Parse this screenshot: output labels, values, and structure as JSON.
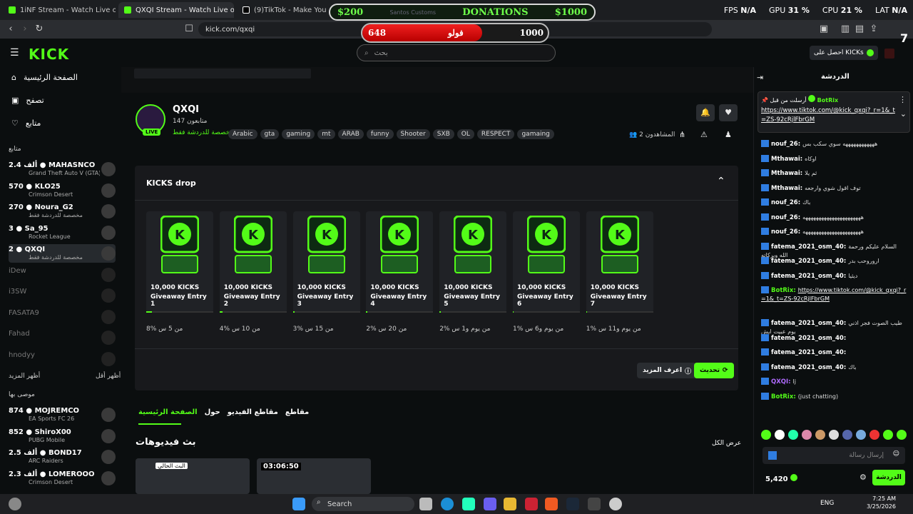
{
  "browser": {
    "tabs": [
      {
        "label": "1iNF Stream - Watch Live on Kick",
        "active": false
      },
      {
        "label": "QXQI Stream - Watch Live on Kick",
        "active": true
      },
      {
        "label": "(9)TikTok - Make Your Day",
        "active": false
      }
    ],
    "url": "kick.com/qxqi"
  },
  "overlay": {
    "donations": {
      "left": "$200",
      "title": "DONATIONS",
      "right": "$1000",
      "faded": "Santos Customs"
    },
    "followers": {
      "current": "648",
      "label": "فولو",
      "goal": "1000",
      "progress": 0.648
    },
    "stats": {
      "fps_label": "FPS",
      "fps": "N/A",
      "gpu_label": "GPU",
      "gpu": "31 %",
      "cpu_label": "CPU",
      "cpu": "21 %",
      "lat_label": "LAT",
      "lat": "N/A"
    }
  },
  "header": {
    "logo": "KICK",
    "search_placeholder": "بحث",
    "get_kicks": "احصل على KICKs",
    "kicks_count": "7"
  },
  "sidebar": {
    "nav": [
      {
        "label": "الصفحة الرئيسية",
        "icon": "home-icon"
      },
      {
        "label": "تصفح",
        "icon": "browse-icon"
      },
      {
        "label": "متابع",
        "icon": "heart-icon"
      }
    ],
    "following_title": "متابع",
    "following": [
      {
        "name": "MAHASNCO",
        "viewers": "2.4 ألف",
        "game": "Grand Theft Auto V (GTA)",
        "live": true
      },
      {
        "name": "KLO25",
        "viewers": "570",
        "game": "Crimson Desert",
        "live": true
      },
      {
        "name": "Noura_G2",
        "viewers": "270",
        "game": "مخصصة للدردشة فقط",
        "live": true
      },
      {
        "name": "Sa_95",
        "viewers": "3",
        "game": "Rocket League",
        "live": true
      },
      {
        "name": "QXQI",
        "viewers": "2",
        "game": "مخصصة للدردشة فقط",
        "live": true
      },
      {
        "name": "iDew",
        "viewers": "",
        "game": "",
        "live": false
      },
      {
        "name": "i3SW",
        "viewers": "",
        "game": "",
        "live": false
      },
      {
        "name": "FASATA9",
        "viewers": "",
        "game": "",
        "live": false
      },
      {
        "name": "Fahad",
        "viewers": "",
        "game": "",
        "live": false
      },
      {
        "name": "hnodyy",
        "viewers": "",
        "game": "",
        "live": false
      }
    ],
    "show_more": "أظهر المزيد",
    "show_less": "أظهر أقل",
    "recommended_title": "موصى بها",
    "recommended": [
      {
        "name": "MOJREMCO",
        "viewers": "874",
        "game": "EA Sports FC 26"
      },
      {
        "name": "ShiroX00",
        "viewers": "852",
        "game": "PUBG Mobile"
      },
      {
        "name": "BOND17",
        "viewers": "2.5 ألف",
        "game": "ARC Raiders"
      },
      {
        "name": "LOMEROOO",
        "viewers": "2.3 ألف",
        "game": "Crimson Desert"
      }
    ]
  },
  "channel": {
    "name": "QXQI",
    "followers": "147 متابعون",
    "category": "مخصصة للدردشة فقط",
    "live_badge": "LIVE",
    "tags": [
      "Arabic",
      "gta",
      "gaming",
      "mt",
      "ARAB",
      "funny",
      "Shooter",
      "SXB",
      "OL",
      "RESPECT",
      "gamaing"
    ],
    "viewers_label": "المشاهدون",
    "viewers": "2"
  },
  "kicks_drop": {
    "title": "KICKS drop",
    "cards": [
      {
        "line1": "10,000 KICKS",
        "line2": "Giveaway Entry 1",
        "progress": "8%",
        "time": "من 5 س",
        "fill": 0.08
      },
      {
        "line1": "10,000 KICKS",
        "line2": "Giveaway Entry 2",
        "progress": "4%",
        "time": "من 10 س",
        "fill": 0.04
      },
      {
        "line1": "10,000 KICKS",
        "line2": "Giveaway Entry 3",
        "progress": "3%",
        "time": "من 15 س",
        "fill": 0.03
      },
      {
        "line1": "10,000 KICKS",
        "line2": "Giveaway Entry 4",
        "progress": "2%",
        "time": "من 20 س",
        "fill": 0.02
      },
      {
        "line1": "10,000 KICKS",
        "line2": "Giveaway Entry 5",
        "progress": "2%",
        "time": "من يوم و1 س",
        "fill": 0.02
      },
      {
        "line1": "10,000 KICKS",
        "line2": "Giveaway Entry 6",
        "progress": "1%",
        "time": "من يوم و6 س",
        "fill": 0.01
      },
      {
        "line1": "10,000 KICKS",
        "line2": "Giveaway Entry 7",
        "progress": "1%",
        "time": "من يوم و11 س",
        "fill": 0.01
      }
    ],
    "learn_more": "اعرف المزيد",
    "update": "تحديث"
  },
  "page_tabs": [
    "الصفحة الرئيسية",
    "حول",
    "مقاطع الفيديو",
    "مقاطع"
  ],
  "videos": {
    "title": "بث فيديوهات",
    "view_all": "عرض الكل",
    "thumb1_label": "البث الحالي",
    "thumb2_time": "03:06:50"
  },
  "chat": {
    "title": "الدردشة",
    "pinned": {
      "user": "BotRix",
      "pinned_by": "أرسلت من قبل",
      "text": "https://www.tiktok.com/@kick_qxqi?_r=1&_t=ZS-92cRjlFbrGM"
    },
    "messages": [
      {
        "user": "nouf_26",
        "text": "ههههههههههههه سوي سكب بس"
      },
      {
        "user": "Mthawai",
        "text": "اوكاه"
      },
      {
        "user": "Mthawai",
        "text": "ثم يلا"
      },
      {
        "user": "Mthawai",
        "text": "توف اقول شوي وارجعه"
      },
      {
        "user": "nouf_26",
        "text": "باك"
      },
      {
        "user": "nouf_26",
        "text": "ههههههههههههههههههههههه"
      },
      {
        "user": "nouf_26",
        "text": "ههههههههههههههههههههههه"
      },
      {
        "user": "fatema_2021_osm_40",
        "text": "السلام عليكم ورحمة الله وبركاته"
      },
      {
        "user": "fatema_2021_osm_40",
        "text": "اروروحب بدر"
      },
      {
        "user": "fatema_2021_osm_40",
        "text": "ديثيا"
      },
      {
        "user": "BotRix",
        "text": "https://www.tiktok.com/@kick_qxqi?_r=1&_t=ZS-92cRjlFbrGM"
      },
      {
        "user": "fatema_2021_osm_40",
        "text": "طيب الصوت فجر اذني يوم عبيت ايش"
      },
      {
        "user": "fatema_2021_osm_40",
        "text": ""
      },
      {
        "user": "fatema_2021_osm_40",
        "text": ""
      },
      {
        "user": "fatema_2021_osm_40",
        "text": "باك"
      },
      {
        "user": "QXQI",
        "text": "lj"
      },
      {
        "user": "BotRix",
        "text": "(just chatting)"
      }
    ],
    "input_placeholder": "إرسال رسالة",
    "balance": "5,420",
    "send": "الدردشة"
  },
  "taskbar": {
    "search": "Search",
    "lang": "ENG",
    "time": "7:25 AM",
    "date": "3/25/2026"
  }
}
